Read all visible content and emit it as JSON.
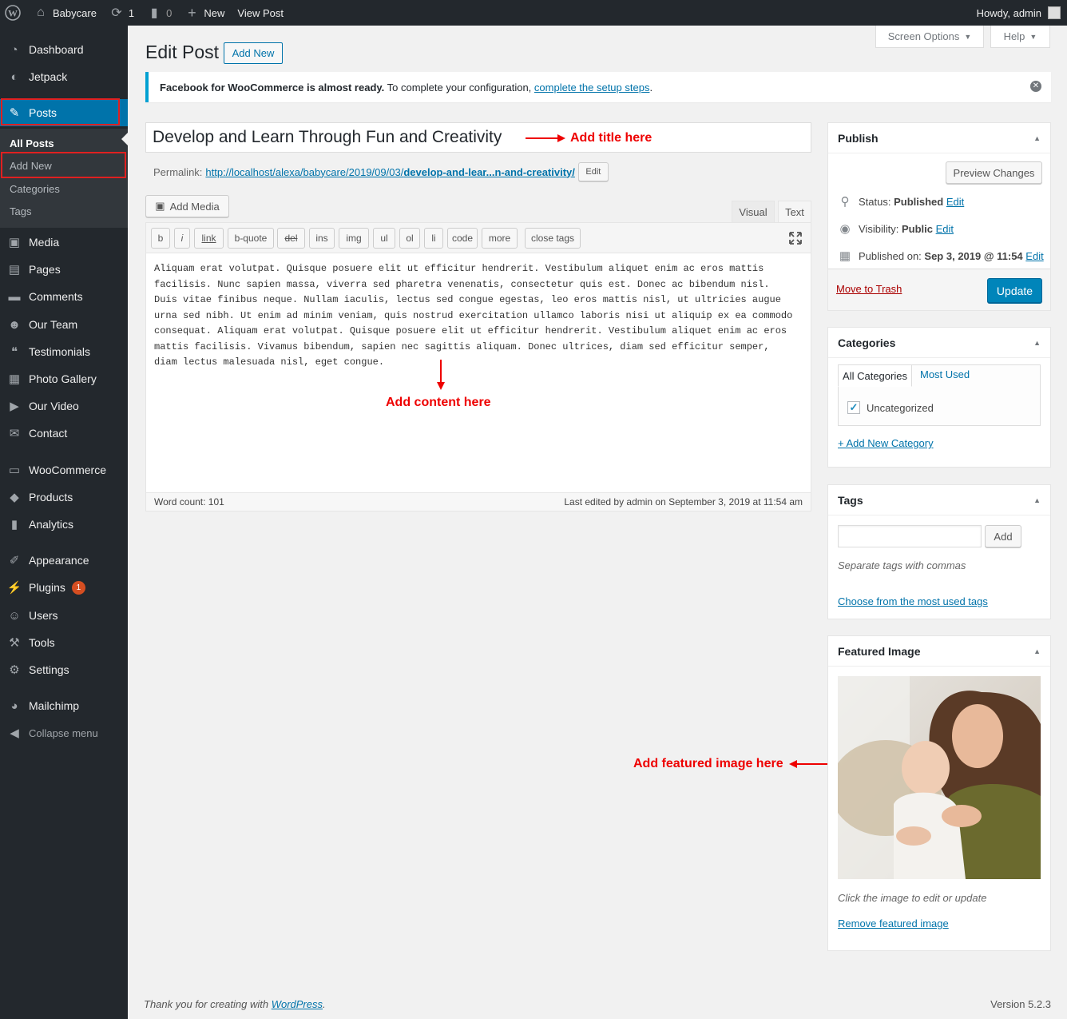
{
  "adminbar": {
    "site_name": "Babycare",
    "updates_count": "1",
    "comments_count": "0",
    "new_label": "New",
    "view_post_label": "View Post",
    "howdy": "Howdy, admin"
  },
  "sidebar": {
    "items": [
      {
        "label": "Dashboard",
        "icon": "dashboard-icon"
      },
      {
        "label": "Jetpack",
        "icon": "jetpack-icon"
      },
      {
        "label": "Posts",
        "icon": "pin-icon"
      },
      {
        "label": "Media",
        "icon": "media-icon"
      },
      {
        "label": "Pages",
        "icon": "pages-icon"
      },
      {
        "label": "Comments",
        "icon": "comments-icon"
      },
      {
        "label": "Our Team",
        "icon": "groups-icon"
      },
      {
        "label": "Testimonials",
        "icon": "quote-icon"
      },
      {
        "label": "Photo Gallery",
        "icon": "gallery-icon"
      },
      {
        "label": "Our Video",
        "icon": "video-icon"
      },
      {
        "label": "Contact",
        "icon": "email-icon"
      },
      {
        "label": "WooCommerce",
        "icon": "woo-icon"
      },
      {
        "label": "Products",
        "icon": "products-icon"
      },
      {
        "label": "Analytics",
        "icon": "analytics-icon"
      },
      {
        "label": "Appearance",
        "icon": "brush-icon"
      },
      {
        "label": "Plugins",
        "icon": "plugins-icon"
      },
      {
        "label": "Users",
        "icon": "users-icon"
      },
      {
        "label": "Tools",
        "icon": "tools-icon"
      },
      {
        "label": "Settings",
        "icon": "settings-icon"
      },
      {
        "label": "Mailchimp",
        "icon": "mailchimp-icon"
      },
      {
        "label": "Collapse menu",
        "icon": "collapse-icon"
      }
    ],
    "plugins_badge": "1",
    "posts_submenu": [
      "All Posts",
      "Add New",
      "Categories",
      "Tags"
    ]
  },
  "screen_options_label": "Screen Options",
  "help_label": "Help",
  "page_title": "Edit Post",
  "add_new_label": "Add New",
  "notice": {
    "bold": "Facebook for WooCommerce is almost ready.",
    "text": " To complete your configuration, ",
    "link": "complete the setup steps",
    "end": "."
  },
  "post_title": "Develop and Learn Through Fun and Creativity",
  "annotations": {
    "title": "Add title here",
    "content": "Add content here",
    "featured": "Add featured image here"
  },
  "permalink": {
    "label": "Permalink:",
    "url_start": "http://localhost/alexa/babycare/2019/09/03/",
    "url_slug": "develop-and-lear...n-and-creativity/",
    "edit_label": "Edit"
  },
  "editor": {
    "add_media_label": "Add Media",
    "tab_visual": "Visual",
    "tab_text": "Text",
    "quicktags": [
      "b",
      "i",
      "link",
      "b-quote",
      "del",
      "ins",
      "img",
      "ul",
      "ol",
      "li",
      "code",
      "more",
      "close tags"
    ],
    "content": "Aliquam erat volutpat. Quisque posuere elit ut efficitur hendrerit. Vestibulum aliquet enim ac eros mattis facilisis. Nunc sapien massa, viverra sed pharetra venenatis, consectetur quis est. Donec ac bibendum nisl. Duis vitae finibus neque. Nullam iaculis, lectus sed congue egestas, leo eros mattis nisl, ut ultricies augue urna sed nibh. Ut enim ad minim veniam, quis nostrud exercitation ullamco laboris nisi ut aliquip ex ea commodo consequat. Aliquam erat volutpat. Quisque posuere elit ut efficitur hendrerit. Vestibulum aliquet enim ac eros mattis facilisis. Vivamus bibendum, sapien nec sagittis aliquam. Donec ultrices, diam sed efficitur semper, diam lectus malesuada nisl, eget congue.",
    "word_count": "Word count: 101",
    "last_edited": "Last edited by admin on September 3, 2019 at 11:54 am"
  },
  "publish": {
    "title": "Publish",
    "preview_label": "Preview Changes",
    "status_label": "Status:",
    "status_value": "Published",
    "visibility_label": "Visibility:",
    "visibility_value": "Public",
    "published_label": "Published on:",
    "published_value": "Sep 3, 2019 @ 11:54",
    "edit_label": "Edit",
    "trash_label": "Move to Trash",
    "update_label": "Update"
  },
  "categories": {
    "title": "Categories",
    "tab_all": "All Categories",
    "tab_most_used": "Most Used",
    "items": [
      "Uncategorized"
    ],
    "add_new": "+ Add New Category"
  },
  "tags": {
    "title": "Tags",
    "add_label": "Add",
    "hint": "Separate tags with commas",
    "choose_link": "Choose from the most used tags"
  },
  "featured_image": {
    "title": "Featured Image",
    "hint": "Click the image to edit or update",
    "remove_link": "Remove featured image"
  },
  "footer": {
    "thanks": "Thank you for creating with ",
    "wp_link": "WordPress",
    "thanks_end": ".",
    "version": "Version 5.2.3"
  },
  "colors": {
    "accent": "#0073aa",
    "sidebar_bg": "#23282d",
    "annotation_red": "#e00000",
    "update_button": "#0085ba"
  }
}
